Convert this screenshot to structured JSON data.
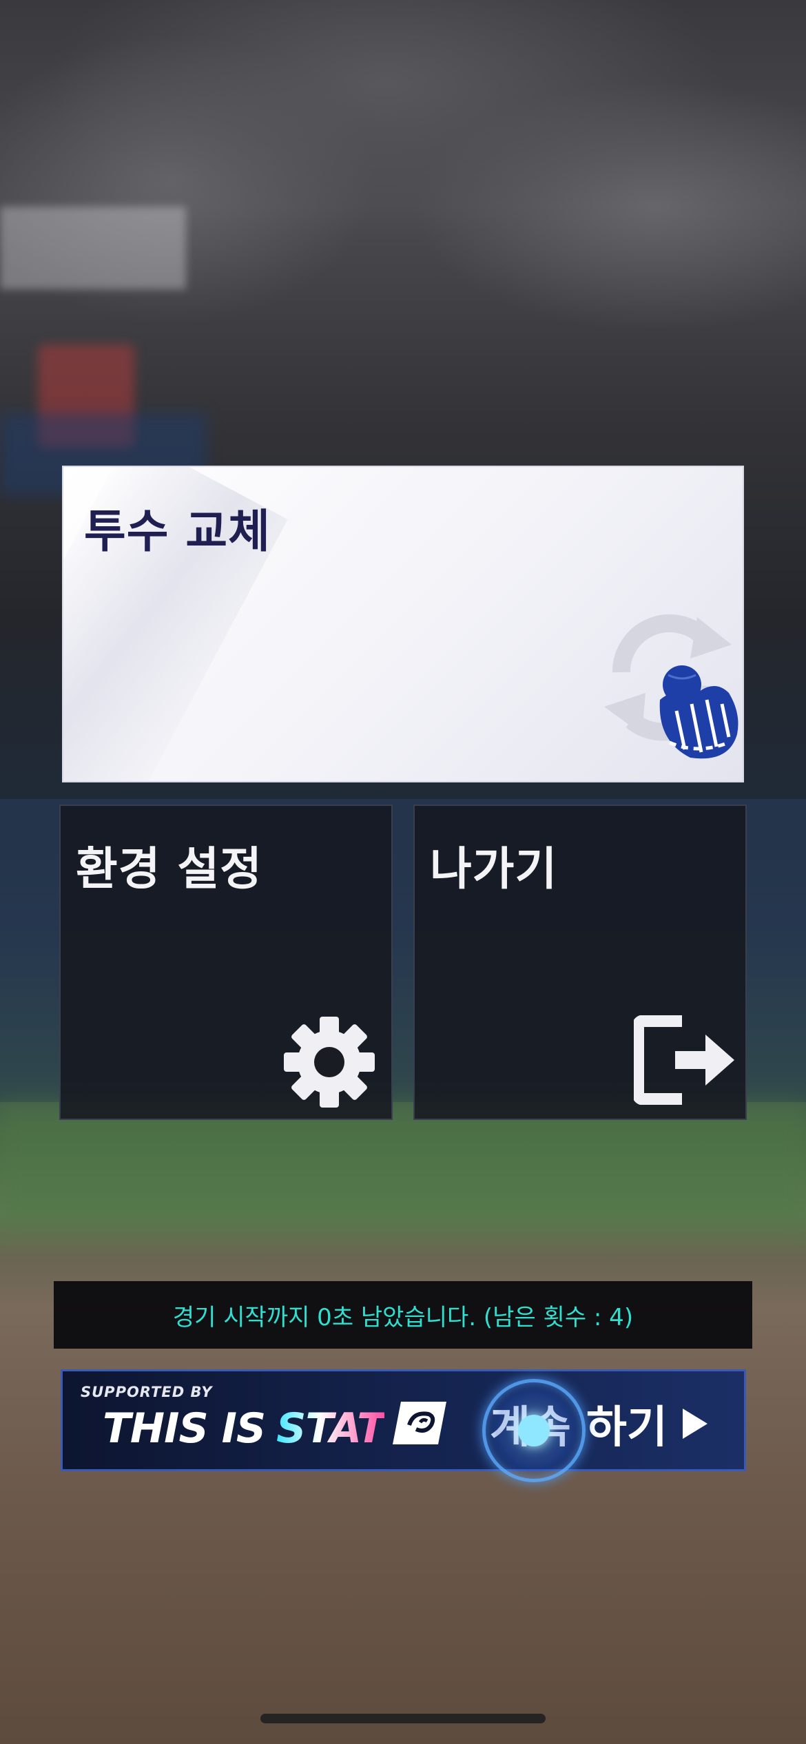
{
  "menu": {
    "pitcher_change": {
      "label": "투수 교체",
      "icon": "pitcher-change-icon"
    },
    "settings": {
      "label": "환경 설정",
      "icon": "gear-icon"
    },
    "exit": {
      "label": "나가기",
      "icon": "exit-icon"
    }
  },
  "notice": {
    "text": "경기 시작까지 0초 남았습니다. (남은 횟수 : 4)"
  },
  "banner": {
    "supported_by": "SUPPORTED BY",
    "brand_white": "THIS IS",
    "brand_color": "STAT",
    "brand_icon": "stat-logo-icon",
    "continue_label": "계속 하기",
    "arrow_icon": "play-arrow-icon"
  },
  "colors": {
    "notice_text": "#2fe0d0",
    "card_title_dark": "#1f1f52",
    "banner_border": "#3a5bb5"
  }
}
